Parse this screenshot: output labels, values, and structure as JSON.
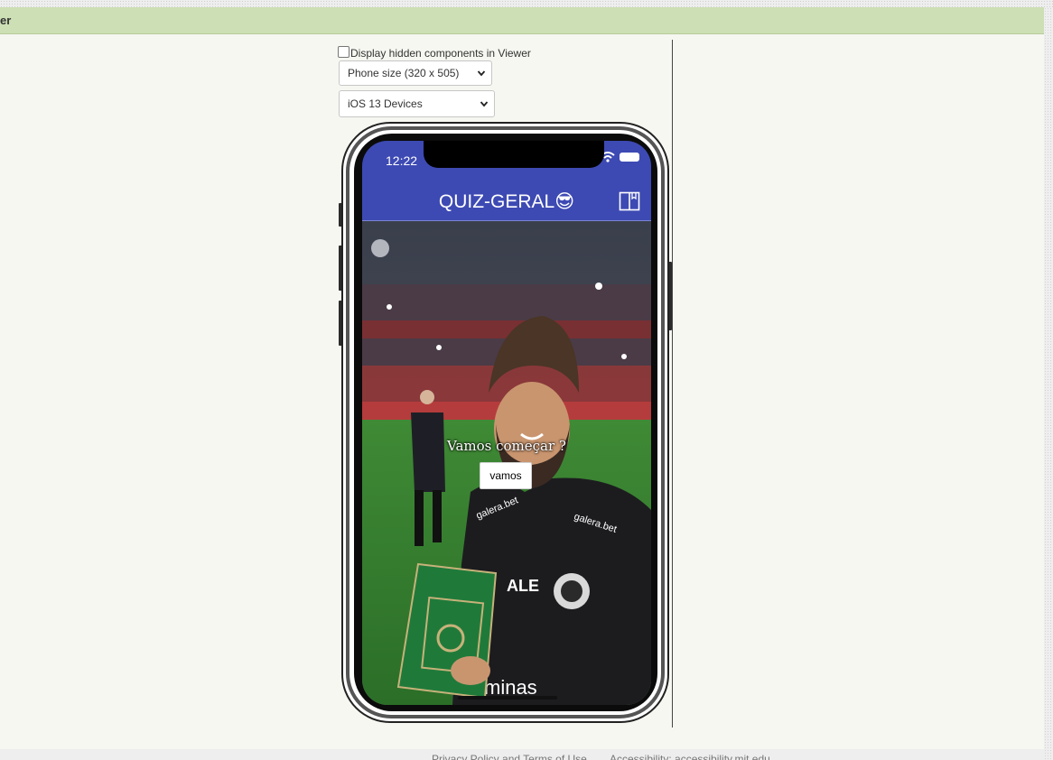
{
  "header": {
    "title": "er"
  },
  "viewer": {
    "hidden_components_label": "Display hidden components in Viewer",
    "hidden_components_checked": false,
    "screen_size_selected": "Phone size (320 x 505)",
    "device_selected": "iOS 13 Devices"
  },
  "phone": {
    "status_time": "12:22",
    "app_title": "QUIZ-GERAL",
    "title_emoji": "😎",
    "question_text": "Vamos começar ?",
    "start_button_label": "vamos",
    "photo_logos": {
      "sponsor_left": "galera.bet",
      "sponsor_right": "galera.bet",
      "chest_sponsor": "ALE",
      "bottom_sponsor": "minas"
    }
  },
  "footer": {
    "privacy_link": "Privacy Policy and Terms of Use",
    "accessibility_link": "Accessibility: accessibility.mit.edu"
  },
  "colors": {
    "header_bg": "#cddfb4",
    "app_bar": "#3d4ab3",
    "page_bg": "#f6f7f1",
    "pitch_green": "#2f7a2c",
    "jersey": "#1c1c1f"
  },
  "icons": [
    "checkbox-icon",
    "chevron-down-icon",
    "wifi-icon",
    "battery-icon",
    "book-icon",
    "sunglasses-emoji-icon"
  ]
}
